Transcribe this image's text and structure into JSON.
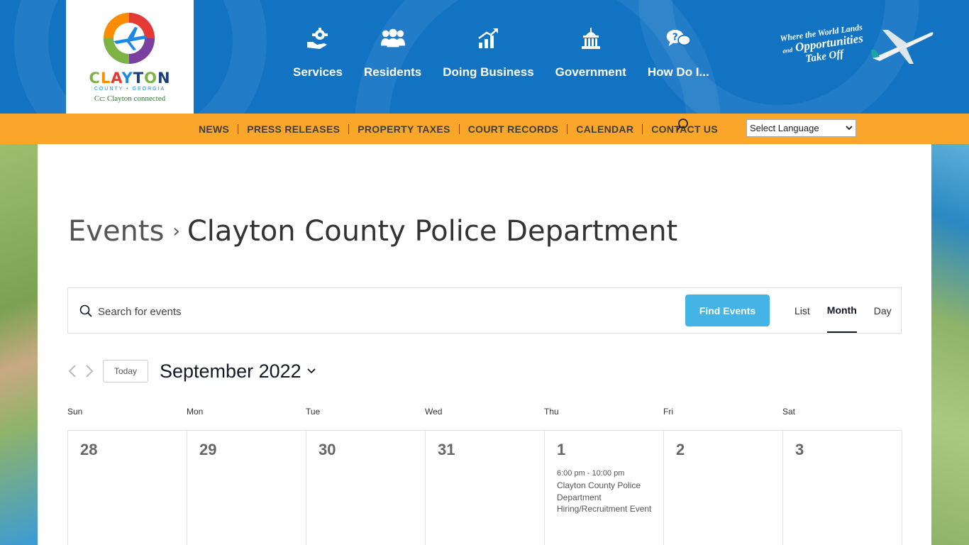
{
  "header": {
    "logo": {
      "word_parts": [
        "C",
        "L",
        "A",
        "Y",
        "T",
        "O",
        "N"
      ],
      "subtitle": "COUNTY • GEORGIA",
      "tagline": "Cc: Clayton connected"
    },
    "nav": [
      {
        "label": "Services",
        "icon": "hand-gear-icon"
      },
      {
        "label": "Residents",
        "icon": "people-icon"
      },
      {
        "label": "Doing Business",
        "icon": "chart-growth-icon"
      },
      {
        "label": "Government",
        "icon": "capitol-building-icon"
      },
      {
        "label": "How Do I...",
        "icon": "question-bubble-icon"
      }
    ],
    "slogan": {
      "line1": "Where the World Lands",
      "line2_prefix": "and",
      "line2": "Opportunities",
      "line3": "Take Off"
    },
    "colors": {
      "header_blue": "#1273c3",
      "subnav_orange": "#f9a62a",
      "button_blue": "#44b3e6"
    }
  },
  "subnav": {
    "links": [
      "NEWS",
      "PRESS RELEASES",
      "PROPERTY TAXES",
      "COURT RECORDS",
      "CALENDAR",
      "CONTACT US"
    ],
    "language_select": "Select Language"
  },
  "page": {
    "breadcrumb_parent": "Events",
    "breadcrumb_current": "Clayton County Police Department"
  },
  "event_bar": {
    "search_placeholder": "Search for events",
    "find_button": "Find Events",
    "views": [
      "List",
      "Month",
      "Day"
    ],
    "active_view": "Month"
  },
  "calendar": {
    "today_label": "Today",
    "month_title": "September 2022",
    "weekdays": [
      "Sun",
      "Mon",
      "Tue",
      "Wed",
      "Thu",
      "Fri",
      "Sat"
    ],
    "days": [
      "28",
      "29",
      "30",
      "31",
      "1",
      "2",
      "3"
    ],
    "event": {
      "time": "6:00 pm - 10:00 pm",
      "title": "Clayton County Police Department Hiring/Recruitment Event"
    }
  }
}
